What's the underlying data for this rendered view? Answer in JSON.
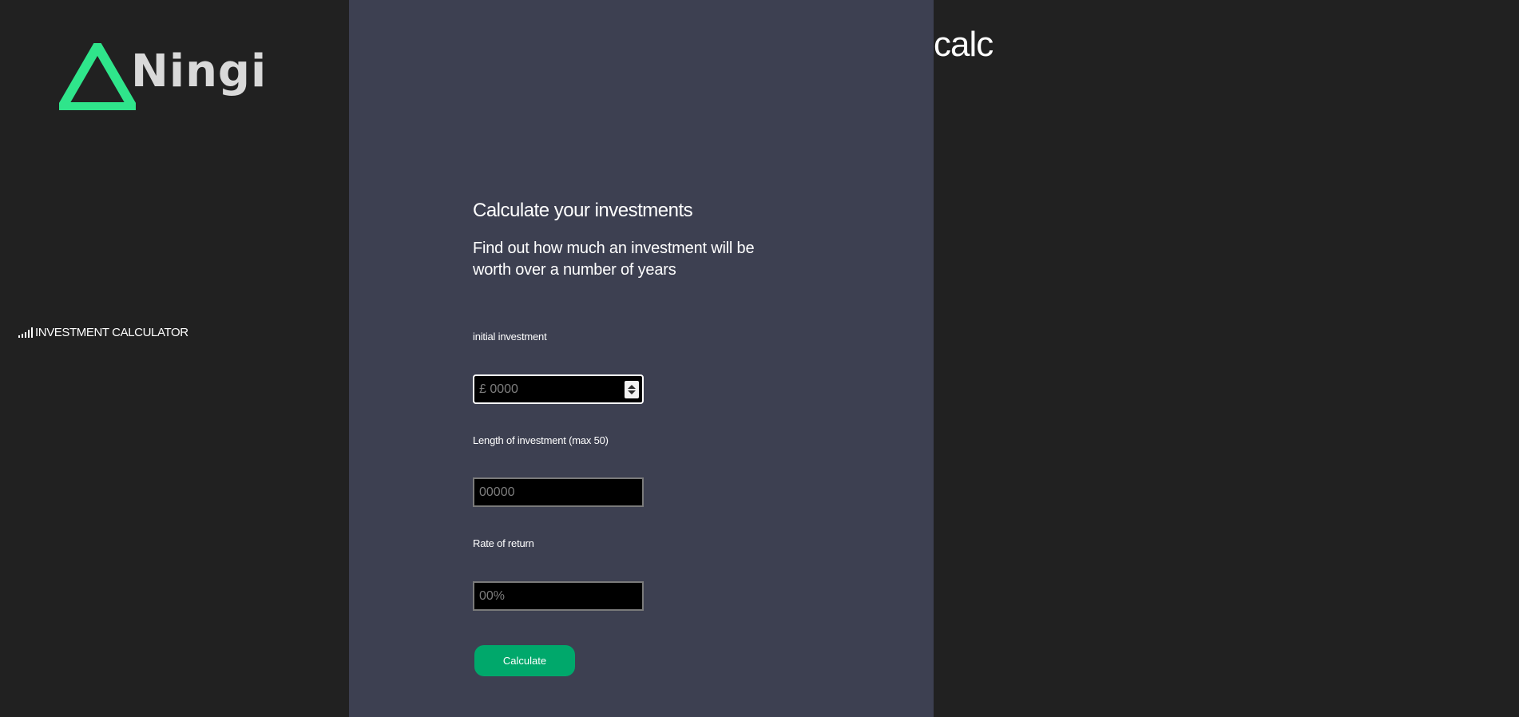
{
  "brand": {
    "name": "Ningi",
    "accent_color": "#2fe58b"
  },
  "sidebar": {
    "items": [
      {
        "icon": "signal-bars-icon",
        "label": "INVESTMENT CALCULATOR"
      }
    ]
  },
  "form": {
    "title": "Calculate your investments",
    "subtitle": "Find out how much an investment will be worth over a number of years",
    "fields": [
      {
        "label": "initial investment",
        "placeholder": "£ 0000",
        "value": ""
      },
      {
        "label": "Length of investment (max 50)",
        "placeholder": "00000",
        "value": ""
      },
      {
        "label": "Rate of return",
        "placeholder": "00%",
        "value": ""
      }
    ],
    "submit_label": "Calculate",
    "button_color": "#00a86b"
  },
  "result": {
    "heading": "calc"
  },
  "colors": {
    "background": "#212121",
    "panel": "#3d4051"
  }
}
